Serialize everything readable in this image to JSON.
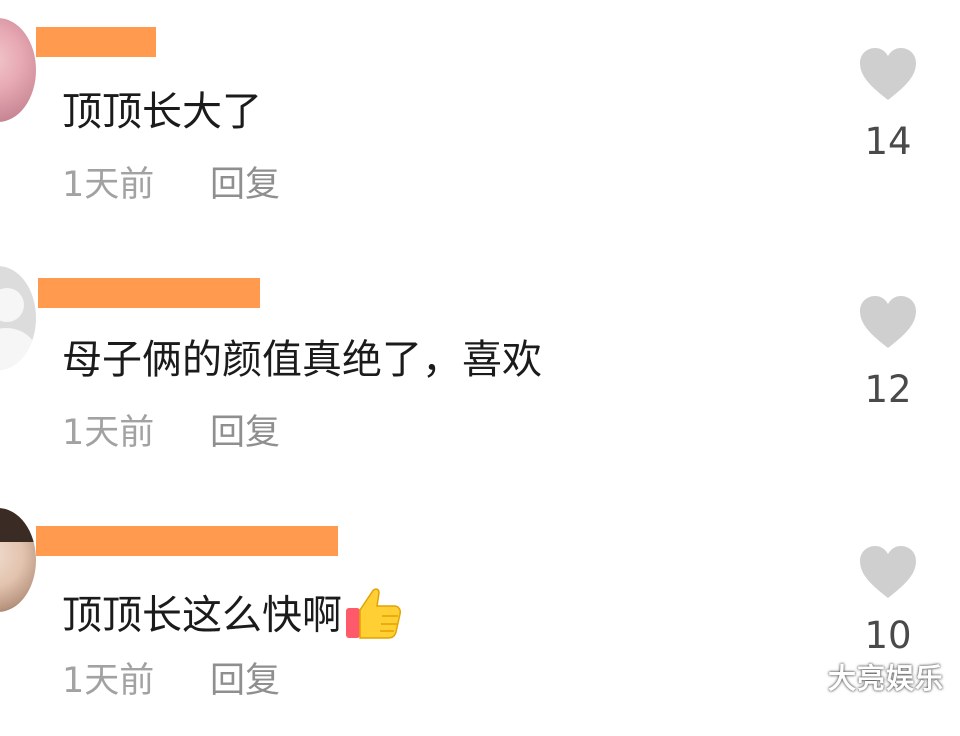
{
  "comments": [
    {
      "text": "顶顶长大了",
      "time": "1天前",
      "reply_label": "回复",
      "likes": "14",
      "name_redacted": true
    },
    {
      "text": "母子俩的颜值真绝了，喜欢",
      "time": "1天前",
      "reply_label": "回复",
      "likes": "12",
      "name_redacted": true
    },
    {
      "text": "顶顶长这么快啊",
      "time": "1天前",
      "reply_label": "回复",
      "likes": "10",
      "name_redacted": true,
      "emoji": "thumbs-up-icon"
    }
  ],
  "watermark": "大亮娱乐",
  "colors": {
    "redaction": "#ff9a4e",
    "heart": "#cfcfcf",
    "text": "#1b1b1b",
    "meta": "#a2a2a2"
  }
}
